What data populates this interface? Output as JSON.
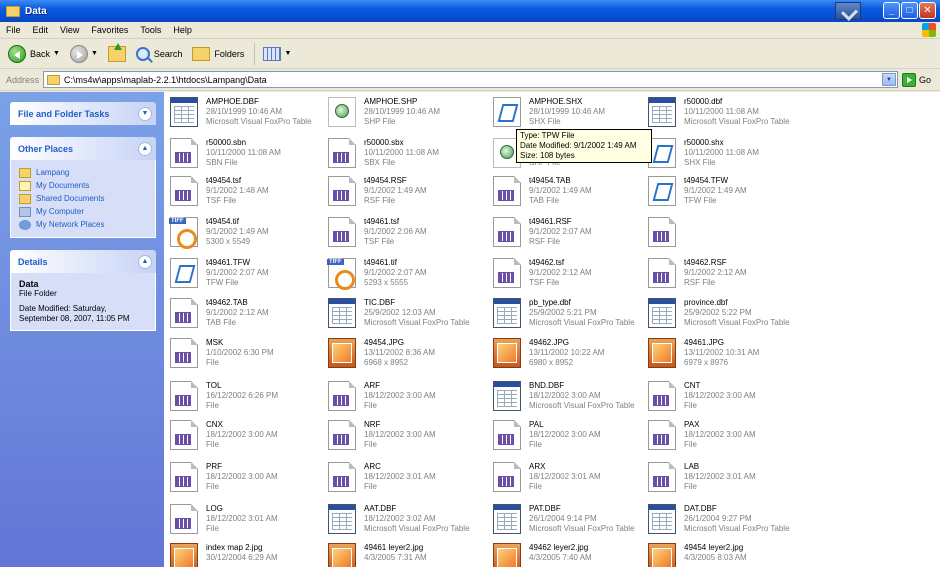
{
  "window": {
    "title": "Data"
  },
  "menu": [
    "File",
    "Edit",
    "View",
    "Favorites",
    "Tools",
    "Help"
  ],
  "toolbar": {
    "back_label": "Back",
    "search_label": "Search",
    "folders_label": "Folders"
  },
  "address": {
    "label": "Address",
    "path": "C:\\ms4w\\apps\\maplab-2.2.1\\htdocs\\Lampang\\Data",
    "go_label": "Go"
  },
  "sidebar": {
    "file_tasks_title": "File and Folder Tasks",
    "other_places_title": "Other Places",
    "places": [
      "Lampang",
      "My Documents",
      "Shared Documents",
      "My Computer",
      "My Network Places"
    ],
    "details_title": "Details",
    "details_name": "Data",
    "details_type": "File Folder",
    "details_date_line1": "Date Modified: Saturday,",
    "details_date_line2": "September 08, 2007, 11:05 PM"
  },
  "tooltip": {
    "line1": "Type: TPW File",
    "line2": "Date Modified: 9/1/2002 1:49 AM",
    "line3": "Size: 108 bytes"
  },
  "files": [
    {
      "name": "AMPHOE.DBF",
      "l2": "28/10/1999 10:46 AM",
      "l3": "Microsoft Visual FoxPro Table",
      "icon": "dbf"
    },
    {
      "name": "AMPHOE.SHP",
      "l2": "28/10/1999 10:46 AM",
      "l3": "SHP File",
      "icon": "shp"
    },
    {
      "name": "AMPHOE.SHX",
      "l2": "28/10/1999 10:46 AM",
      "l3": "SHX File",
      "icon": "txt"
    },
    {
      "name": "r50000.dbf",
      "l2": "10/11/2000 11:08 AM",
      "l3": "Microsoft Visual FoxPro Table",
      "icon": "dbf"
    },
    {
      "name": "r50000.sbn",
      "l2": "10/11/2000 11:08 AM",
      "l3": "SBN File",
      "icon": "gen"
    },
    {
      "name": "r50000.sbx",
      "l2": "10/11/2000 11:08 AM",
      "l3": "SBX File",
      "icon": "gen"
    },
    {
      "name": "r50000.shp",
      "l2": "10/11/2000 11:08 AM",
      "l3": "SHP File",
      "icon": "shp"
    },
    {
      "name": "r50000.shx",
      "l2": "10/11/2000 11:08 AM",
      "l3": "SHX File",
      "icon": "txt"
    },
    {
      "name": "t49454.tsf",
      "l2": "9/1/2002 1:48 AM",
      "l3": "TSF File",
      "icon": "gen"
    },
    {
      "name": "t49454.RSF",
      "l2": "9/1/2002 1:49 AM",
      "l3": "RSF File",
      "icon": "gen"
    },
    {
      "name": "t49454.TAB",
      "l2": "9/1/2002 1:49 AM",
      "l3": "TAB File",
      "icon": "gen"
    },
    {
      "name": "t49454.TFW",
      "l2": "9/1/2002 1:49 AM",
      "l3": "TFW File",
      "icon": "txt"
    },
    {
      "name": "t49454.tif",
      "l2": "9/1/2002 1:49 AM",
      "l3": "5300 x 5549",
      "icon": "tiff"
    },
    {
      "name": "t49461.tsf",
      "l2": "9/1/2002 2:06 AM",
      "l3": "TSF File",
      "icon": "gen"
    },
    {
      "name": "t49461.RSF",
      "l2": "9/1/2002 2:07 AM",
      "l3": "RSF File",
      "icon": "gen"
    },
    {
      "name": "",
      "l2": "",
      "l3": "",
      "icon": "gen"
    },
    {
      "name": "t49461.TFW",
      "l2": "9/1/2002 2:07 AM",
      "l3": "TFW File",
      "icon": "txt"
    },
    {
      "name": "t49461.tif",
      "l2": "9/1/2002 2:07 AM",
      "l3": "5293 x 5555",
      "icon": "tiff"
    },
    {
      "name": "t49462.tsf",
      "l2": "9/1/2002 2:12 AM",
      "l3": "TSF File",
      "icon": "gen"
    },
    {
      "name": "t49462.RSF",
      "l2": "9/1/2002 2:12 AM",
      "l3": "RSF File",
      "icon": "gen"
    },
    {
      "name": "t49462.TAB",
      "l2": "9/1/2002 2:12 AM",
      "l3": "TAB File",
      "icon": "gen"
    },
    {
      "name": "TIC.DBF",
      "l2": "25/9/2002 12:03 AM",
      "l3": "Microsoft Visual FoxPro Table",
      "icon": "dbf"
    },
    {
      "name": "pb_type.dbf",
      "l2": "25/9/2002 5:21 PM",
      "l3": "Microsoft Visual FoxPro Table",
      "icon": "dbf"
    },
    {
      "name": "province.dbf",
      "l2": "25/9/2002 5:22 PM",
      "l3": "Microsoft Visual FoxPro Table",
      "icon": "dbf"
    },
    {
      "name": "MSK",
      "l2": "1/10/2002 6:30 PM",
      "l3": "File",
      "icon": "gen"
    },
    {
      "name": "49454.JPG",
      "l2": "13/11/2002 8:36 AM",
      "l3": "6968 x 8952",
      "icon": "jpg"
    },
    {
      "name": "49462.JPG",
      "l2": "13/11/2002 10:22 AM",
      "l3": "6980 x 8952",
      "icon": "jpg"
    },
    {
      "name": "49461.JPG",
      "l2": "13/11/2002 10:31 AM",
      "l3": "6979 x 8976",
      "icon": "jpg"
    },
    {
      "name": "TOL",
      "l2": "16/12/2002 6:26 PM",
      "l3": "File",
      "icon": "gen"
    },
    {
      "name": "ARF",
      "l2": "18/12/2002 3:00 AM",
      "l3": "File",
      "icon": "gen"
    },
    {
      "name": "BND.DBF",
      "l2": "18/12/2002 3:00 AM",
      "l3": "Microsoft Visual FoxPro Table",
      "icon": "dbf"
    },
    {
      "name": "CNT",
      "l2": "18/12/2002 3:00 AM",
      "l3": "File",
      "icon": "gen"
    },
    {
      "name": "CNX",
      "l2": "18/12/2002 3:00 AM",
      "l3": "File",
      "icon": "gen"
    },
    {
      "name": "NRF",
      "l2": "18/12/2002 3:00 AM",
      "l3": "File",
      "icon": "gen"
    },
    {
      "name": "PAL",
      "l2": "18/12/2002 3:00 AM",
      "l3": "File",
      "icon": "gen"
    },
    {
      "name": "PAX",
      "l2": "18/12/2002 3:00 AM",
      "l3": "File",
      "icon": "gen"
    },
    {
      "name": "PRF",
      "l2": "18/12/2002 3:00 AM",
      "l3": "File",
      "icon": "gen"
    },
    {
      "name": "ARC",
      "l2": "18/12/2002 3:01 AM",
      "l3": "File",
      "icon": "gen"
    },
    {
      "name": "ARX",
      "l2": "18/12/2002 3:01 AM",
      "l3": "File",
      "icon": "gen"
    },
    {
      "name": "LAB",
      "l2": "18/12/2002 3:01 AM",
      "l3": "File",
      "icon": "gen"
    },
    {
      "name": "LOG",
      "l2": "18/12/2002 3:01 AM",
      "l3": "File",
      "icon": "gen"
    },
    {
      "name": "AAT.DBF",
      "l2": "18/12/2002 3:02 AM",
      "l3": "Microsoft Visual FoxPro Table",
      "icon": "dbf"
    },
    {
      "name": "PAT.DBF",
      "l2": "26/1/2004 9:14 PM",
      "l3": "Microsoft Visual FoxPro Table",
      "icon": "dbf"
    },
    {
      "name": "DAT.DBF",
      "l2": "26/1/2004 9:27 PM",
      "l3": "Microsoft Visual FoxPro Table",
      "icon": "dbf"
    },
    {
      "name": "index map 2.jpg",
      "l2": "30/12/2004 6:29 AM",
      "l3": "",
      "icon": "jpg"
    },
    {
      "name": "49461 leyer2.jpg",
      "l2": "4/3/2005 7:31 AM",
      "l3": "",
      "icon": "jpg"
    },
    {
      "name": "49462 leyer2.jpg",
      "l2": "4/3/2005 7:40 AM",
      "l3": "",
      "icon": "jpg"
    },
    {
      "name": "49454 leyer2.jpg",
      "l2": "4/3/2005 8:03 AM",
      "l3": "",
      "icon": "jpg"
    }
  ]
}
